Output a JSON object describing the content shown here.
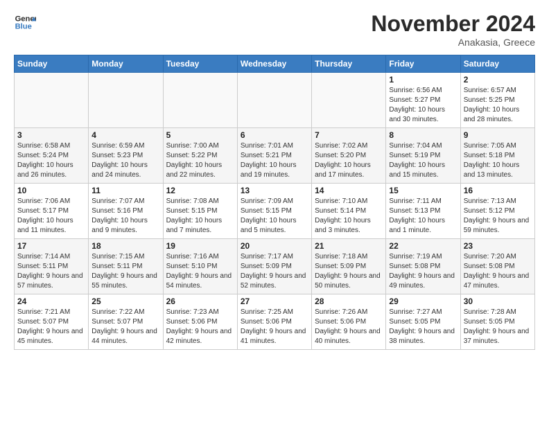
{
  "logo": {
    "line1": "General",
    "line2": "Blue"
  },
  "title": "November 2024",
  "subtitle": "Anakasia, Greece",
  "days_of_week": [
    "Sunday",
    "Monday",
    "Tuesday",
    "Wednesday",
    "Thursday",
    "Friday",
    "Saturday"
  ],
  "weeks": [
    [
      {
        "day": "",
        "info": ""
      },
      {
        "day": "",
        "info": ""
      },
      {
        "day": "",
        "info": ""
      },
      {
        "day": "",
        "info": ""
      },
      {
        "day": "",
        "info": ""
      },
      {
        "day": "1",
        "info": "Sunrise: 6:56 AM\nSunset: 5:27 PM\nDaylight: 10 hours and 30 minutes."
      },
      {
        "day": "2",
        "info": "Sunrise: 6:57 AM\nSunset: 5:25 PM\nDaylight: 10 hours and 28 minutes."
      }
    ],
    [
      {
        "day": "3",
        "info": "Sunrise: 6:58 AM\nSunset: 5:24 PM\nDaylight: 10 hours and 26 minutes."
      },
      {
        "day": "4",
        "info": "Sunrise: 6:59 AM\nSunset: 5:23 PM\nDaylight: 10 hours and 24 minutes."
      },
      {
        "day": "5",
        "info": "Sunrise: 7:00 AM\nSunset: 5:22 PM\nDaylight: 10 hours and 22 minutes."
      },
      {
        "day": "6",
        "info": "Sunrise: 7:01 AM\nSunset: 5:21 PM\nDaylight: 10 hours and 19 minutes."
      },
      {
        "day": "7",
        "info": "Sunrise: 7:02 AM\nSunset: 5:20 PM\nDaylight: 10 hours and 17 minutes."
      },
      {
        "day": "8",
        "info": "Sunrise: 7:04 AM\nSunset: 5:19 PM\nDaylight: 10 hours and 15 minutes."
      },
      {
        "day": "9",
        "info": "Sunrise: 7:05 AM\nSunset: 5:18 PM\nDaylight: 10 hours and 13 minutes."
      }
    ],
    [
      {
        "day": "10",
        "info": "Sunrise: 7:06 AM\nSunset: 5:17 PM\nDaylight: 10 hours and 11 minutes."
      },
      {
        "day": "11",
        "info": "Sunrise: 7:07 AM\nSunset: 5:16 PM\nDaylight: 10 hours and 9 minutes."
      },
      {
        "day": "12",
        "info": "Sunrise: 7:08 AM\nSunset: 5:15 PM\nDaylight: 10 hours and 7 minutes."
      },
      {
        "day": "13",
        "info": "Sunrise: 7:09 AM\nSunset: 5:15 PM\nDaylight: 10 hours and 5 minutes."
      },
      {
        "day": "14",
        "info": "Sunrise: 7:10 AM\nSunset: 5:14 PM\nDaylight: 10 hours and 3 minutes."
      },
      {
        "day": "15",
        "info": "Sunrise: 7:11 AM\nSunset: 5:13 PM\nDaylight: 10 hours and 1 minute."
      },
      {
        "day": "16",
        "info": "Sunrise: 7:13 AM\nSunset: 5:12 PM\nDaylight: 9 hours and 59 minutes."
      }
    ],
    [
      {
        "day": "17",
        "info": "Sunrise: 7:14 AM\nSunset: 5:11 PM\nDaylight: 9 hours and 57 minutes."
      },
      {
        "day": "18",
        "info": "Sunrise: 7:15 AM\nSunset: 5:11 PM\nDaylight: 9 hours and 55 minutes."
      },
      {
        "day": "19",
        "info": "Sunrise: 7:16 AM\nSunset: 5:10 PM\nDaylight: 9 hours and 54 minutes."
      },
      {
        "day": "20",
        "info": "Sunrise: 7:17 AM\nSunset: 5:09 PM\nDaylight: 9 hours and 52 minutes."
      },
      {
        "day": "21",
        "info": "Sunrise: 7:18 AM\nSunset: 5:09 PM\nDaylight: 9 hours and 50 minutes."
      },
      {
        "day": "22",
        "info": "Sunrise: 7:19 AM\nSunset: 5:08 PM\nDaylight: 9 hours and 49 minutes."
      },
      {
        "day": "23",
        "info": "Sunrise: 7:20 AM\nSunset: 5:08 PM\nDaylight: 9 hours and 47 minutes."
      }
    ],
    [
      {
        "day": "24",
        "info": "Sunrise: 7:21 AM\nSunset: 5:07 PM\nDaylight: 9 hours and 45 minutes."
      },
      {
        "day": "25",
        "info": "Sunrise: 7:22 AM\nSunset: 5:07 PM\nDaylight: 9 hours and 44 minutes."
      },
      {
        "day": "26",
        "info": "Sunrise: 7:23 AM\nSunset: 5:06 PM\nDaylight: 9 hours and 42 minutes."
      },
      {
        "day": "27",
        "info": "Sunrise: 7:25 AM\nSunset: 5:06 PM\nDaylight: 9 hours and 41 minutes."
      },
      {
        "day": "28",
        "info": "Sunrise: 7:26 AM\nSunset: 5:06 PM\nDaylight: 9 hours and 40 minutes."
      },
      {
        "day": "29",
        "info": "Sunrise: 7:27 AM\nSunset: 5:05 PM\nDaylight: 9 hours and 38 minutes."
      },
      {
        "day": "30",
        "info": "Sunrise: 7:28 AM\nSunset: 5:05 PM\nDaylight: 9 hours and 37 minutes."
      }
    ]
  ]
}
